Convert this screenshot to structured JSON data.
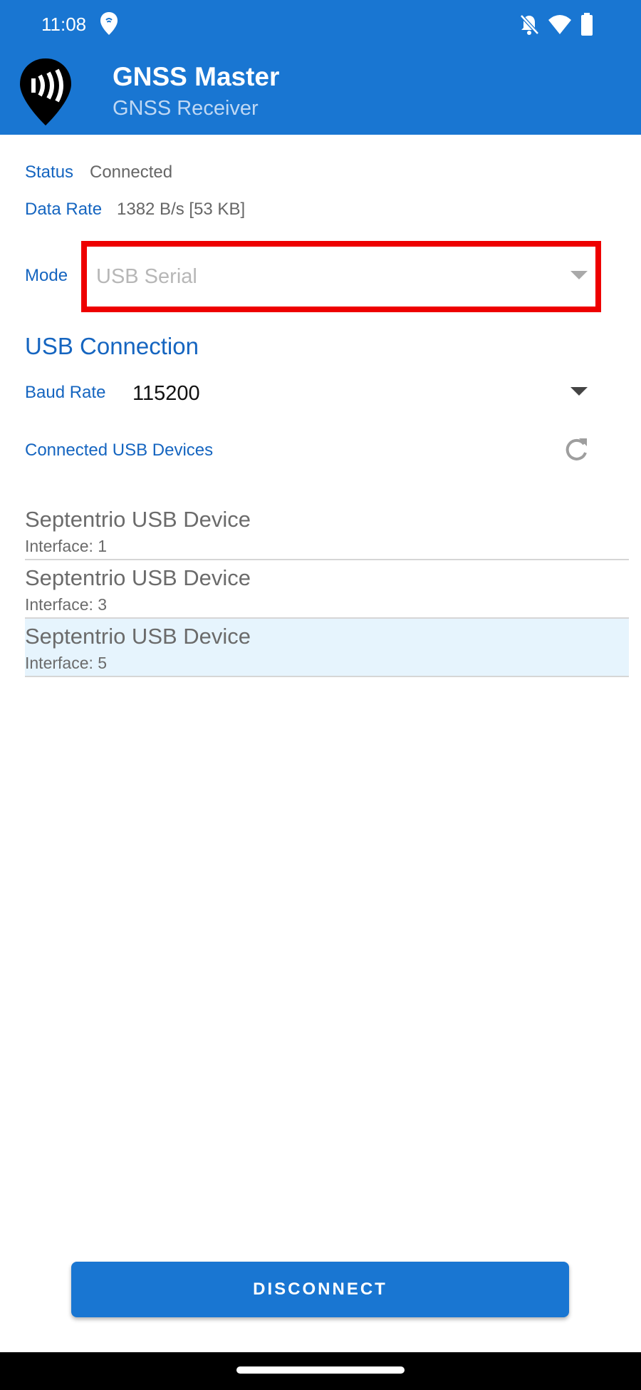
{
  "status_bar": {
    "time": "11:08",
    "icons": [
      "location-pin-icon",
      "notifications-off-icon",
      "wifi-icon",
      "battery-icon"
    ]
  },
  "app_bar": {
    "title": "GNSS Master",
    "subtitle": "GNSS Receiver",
    "logo_icon": "gnss-master-logo-icon"
  },
  "info": {
    "status_label": "Status",
    "status_value": "Connected",
    "data_rate_label": "Data Rate",
    "data_rate_value": "1382 B/s [53 KB]"
  },
  "mode": {
    "label": "Mode",
    "value": "USB Serial"
  },
  "usb": {
    "section_title": "USB Connection",
    "baud_label": "Baud Rate",
    "baud_value": "115200",
    "devices_label": "Connected USB Devices",
    "devices": [
      {
        "name": "Septentrio USB Device",
        "interface": "Interface: 1",
        "selected": false
      },
      {
        "name": "Septentrio USB Device",
        "interface": "Interface: 3",
        "selected": false
      },
      {
        "name": "Septentrio USB Device",
        "interface": "Interface: 5",
        "selected": true
      }
    ]
  },
  "actions": {
    "disconnect_label": "DISCONNECT"
  },
  "colors": {
    "primary": "#1976d2",
    "label_blue": "#1565c0",
    "highlight_frame": "#ee0000",
    "selected_row": "#e6f4fd"
  }
}
